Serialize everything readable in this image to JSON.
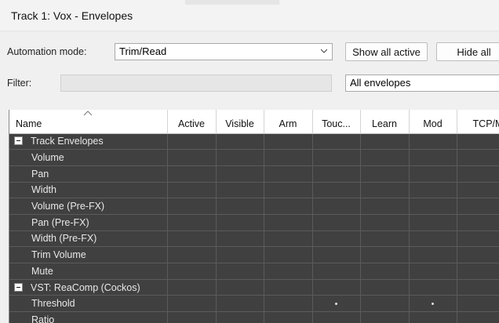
{
  "window": {
    "title": "Track 1: Vox - Envelopes"
  },
  "toolbar": {
    "automation_mode_label": "Automation mode:",
    "automation_mode_value": "Trim/Read",
    "show_all_active_label": "Show all active",
    "hide_all_label": "Hide all"
  },
  "filter": {
    "label": "Filter:",
    "value": "",
    "scope_value": "All envelopes"
  },
  "grid": {
    "columns": [
      "Name",
      "Active",
      "Visible",
      "Arm",
      "Touc...",
      "Learn",
      "Mod",
      "TCP/M"
    ],
    "rows": [
      {
        "name": "Track Envelopes",
        "group": true,
        "cells": [
          "",
          "",
          "",
          "",
          "",
          "",
          ""
        ]
      },
      {
        "name": "Volume",
        "group": false,
        "cells": [
          "",
          "",
          "",
          "",
          "",
          "",
          ""
        ]
      },
      {
        "name": "Pan",
        "group": false,
        "cells": [
          "",
          "",
          "",
          "",
          "",
          "",
          ""
        ]
      },
      {
        "name": "Width",
        "group": false,
        "cells": [
          "",
          "",
          "",
          "",
          "",
          "",
          ""
        ]
      },
      {
        "name": "Volume (Pre-FX)",
        "group": false,
        "cells": [
          "",
          "",
          "",
          "",
          "",
          "",
          ""
        ]
      },
      {
        "name": "Pan (Pre-FX)",
        "group": false,
        "cells": [
          "",
          "",
          "",
          "",
          "",
          "",
          ""
        ]
      },
      {
        "name": "Width (Pre-FX)",
        "group": false,
        "cells": [
          "",
          "",
          "",
          "",
          "",
          "",
          ""
        ]
      },
      {
        "name": "Trim Volume",
        "group": false,
        "cells": [
          "",
          "",
          "",
          "",
          "",
          "",
          ""
        ]
      },
      {
        "name": "Mute",
        "group": false,
        "cells": [
          "",
          "",
          "",
          "",
          "",
          "",
          ""
        ]
      },
      {
        "name": "VST: ReaComp (Cockos)",
        "group": true,
        "cells": [
          "",
          "",
          "",
          "",
          "",
          "",
          ""
        ]
      },
      {
        "name": "Threshold",
        "group": false,
        "cells": [
          "",
          "",
          "",
          "•",
          "",
          "•",
          ""
        ]
      },
      {
        "name": "Ratio",
        "group": false,
        "cells": [
          "",
          "",
          "",
          "",
          "",
          "",
          ""
        ]
      }
    ]
  }
}
